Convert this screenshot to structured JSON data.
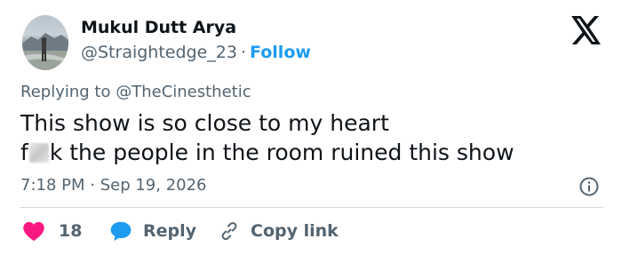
{
  "author": {
    "name": "Mukul Dutt Arya",
    "handle": "@Straightedge_23",
    "separator": "·",
    "follow_label": "Follow"
  },
  "reply_context": {
    "prefix": "Replying to",
    "mention": "@TheCinesthetic"
  },
  "tweet": {
    "line1": "This show is so close to my heart",
    "line2_start": "f",
    "line2_end": "k the people in the room ruined this show"
  },
  "timestamp": "7:18 PM · Sep 19, 2026",
  "actions": {
    "like_count": "18",
    "reply_label": "Reply",
    "copy_label": "Copy link"
  },
  "icons": {
    "brand": "x-logo-icon",
    "info": "info-icon",
    "like": "heart-icon",
    "reply": "speech-bubble-icon",
    "copy": "link-icon"
  },
  "colors": {
    "accent": "#1d9bf0",
    "like": "#f91880",
    "text": "#0f1419",
    "muted": "#536471"
  }
}
